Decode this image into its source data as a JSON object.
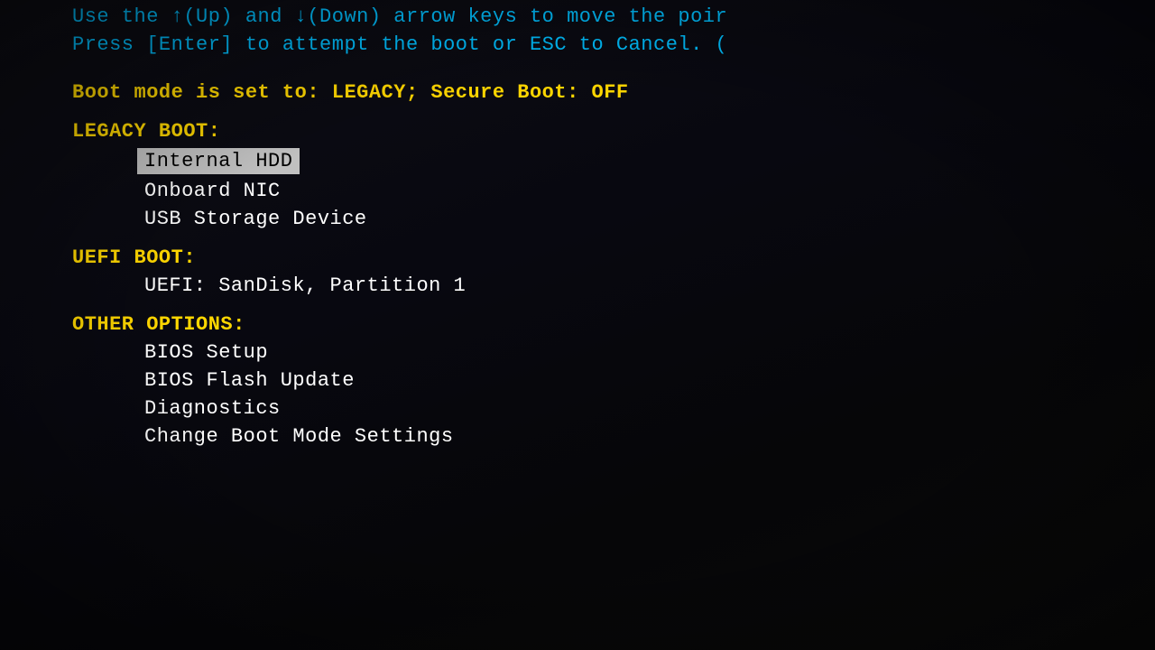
{
  "header": {
    "line1": "Use the ↑(Up) and ↓(Down) arrow keys to move the poir",
    "line2": "Press [Enter] to attempt the boot or ESC to Cancel. ("
  },
  "boot_mode_line": "Boot mode is set to:  LEGACY; Secure Boot: OFF",
  "legacy_boot": {
    "section_label": "LEGACY BOOT:",
    "items": [
      {
        "label": "Internal HDD",
        "selected": true
      },
      {
        "label": "Onboard NIC",
        "selected": false
      },
      {
        "label": "USB Storage Device",
        "selected": false
      }
    ]
  },
  "uefi_boot": {
    "section_label": "UEFI BOOT:",
    "items": [
      {
        "label": "UEFI: SanDisk, Partition 1",
        "selected": false
      }
    ]
  },
  "other_options": {
    "section_label": "OTHER OPTIONS:",
    "items": [
      {
        "label": "BIOS Setup",
        "selected": false
      },
      {
        "label": "BIOS Flash Update",
        "selected": false
      },
      {
        "label": "Diagnostics",
        "selected": false
      },
      {
        "label": "Change Boot Mode Settings",
        "selected": false
      }
    ]
  }
}
